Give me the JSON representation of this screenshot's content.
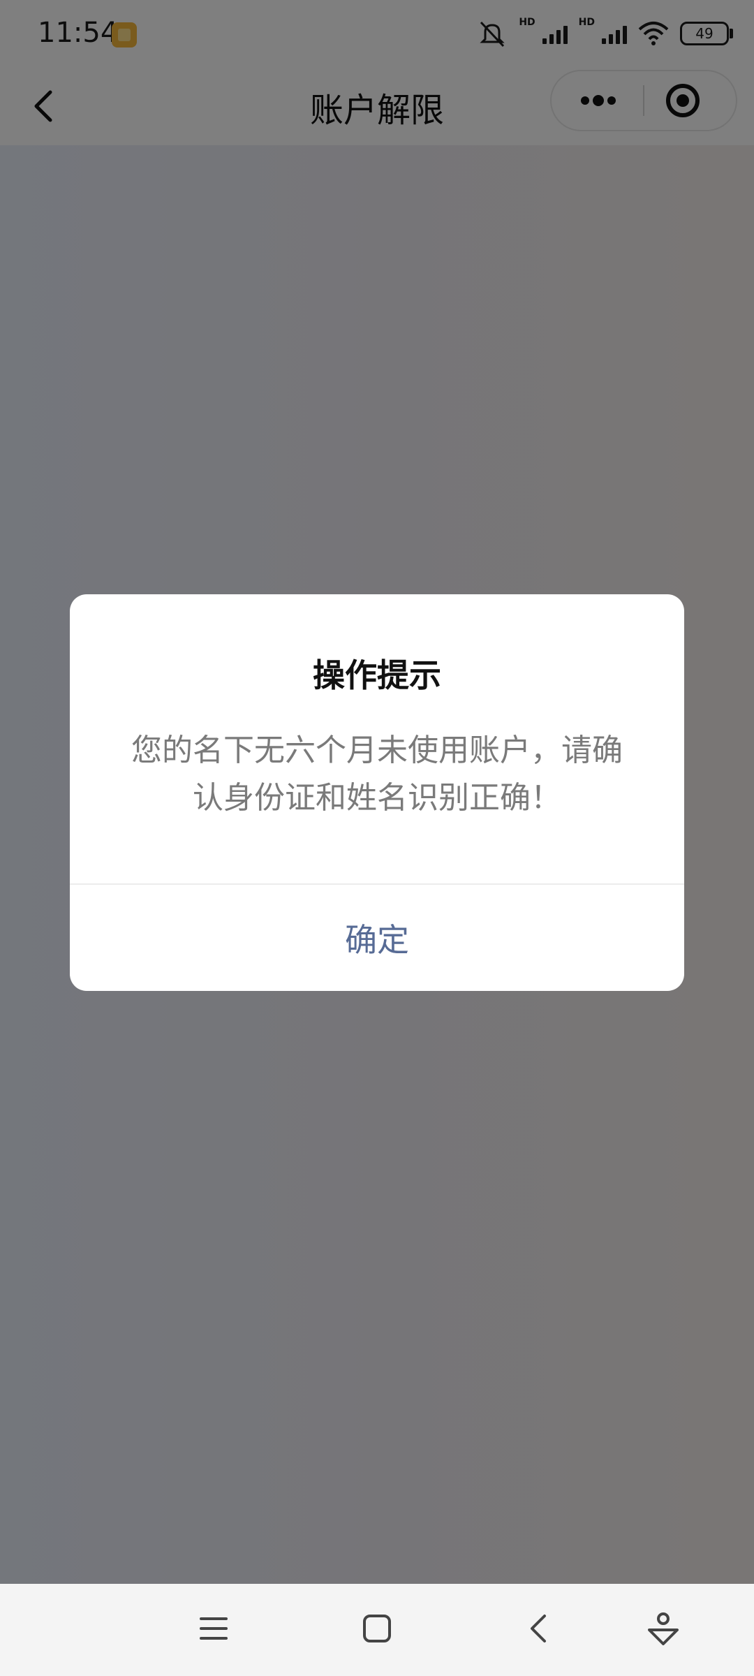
{
  "status_bar": {
    "time": "11:54",
    "battery": "49",
    "signal_labels": [
      "HD",
      "HD"
    ]
  },
  "nav": {
    "title": "账户解限"
  },
  "dialog": {
    "title": "操作提示",
    "message": "您的名下无六个月未使用账户，请确认身份证和姓名识别正确！",
    "confirm_label": "确定"
  },
  "icons": {
    "back": "back-chevron-icon",
    "more": "more-dots-icon",
    "close": "target-close-icon",
    "menu": "menu-lines-icon",
    "home": "home-square-icon",
    "sys_back": "back-triangle-icon",
    "assistant": "assistant-icon"
  },
  "colors": {
    "link": "#576b95",
    "overlay": "rgba(0,0,0,0.5)"
  }
}
